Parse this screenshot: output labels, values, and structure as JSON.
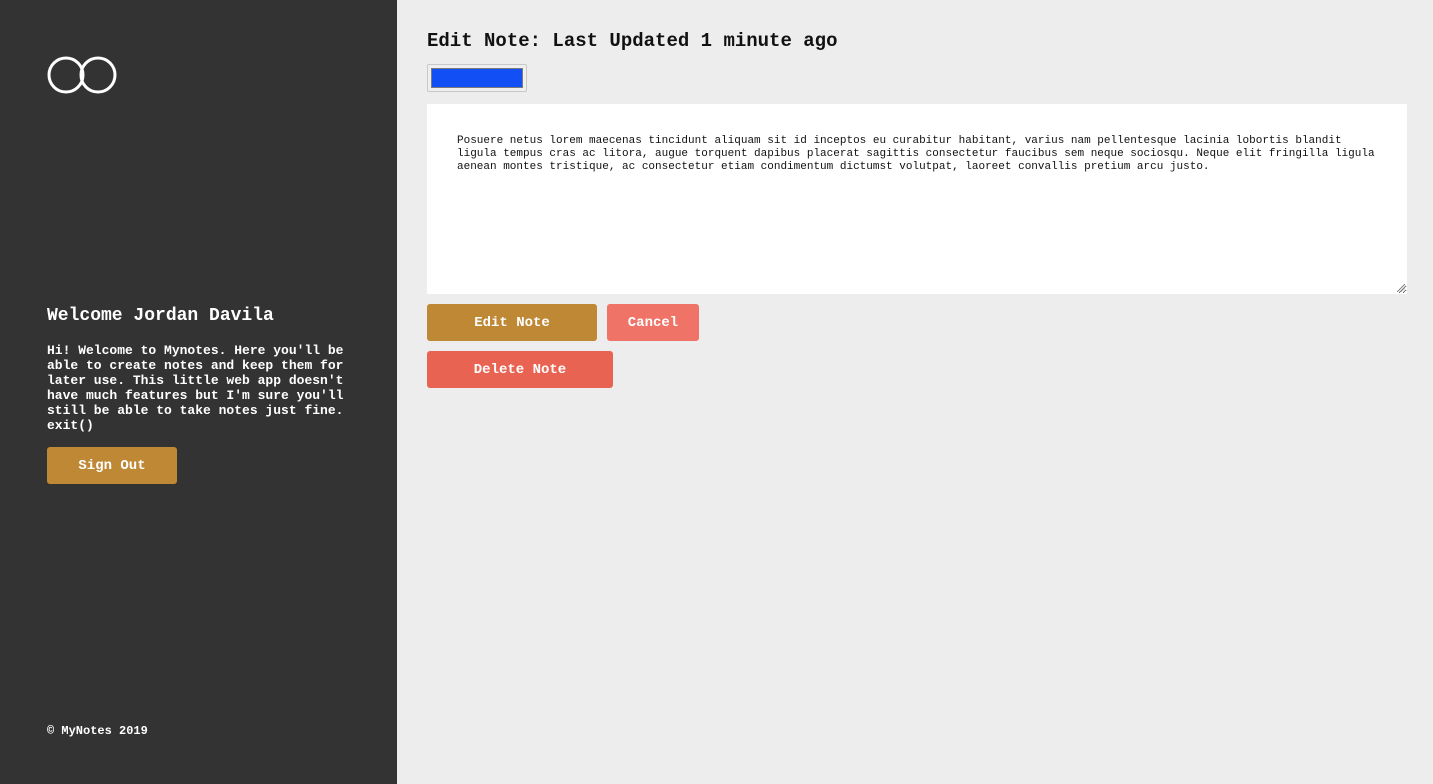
{
  "sidebar": {
    "logo_icon": "infinity-rings-icon",
    "welcome_title": "Welcome Jordan Davila",
    "welcome_lines": [
      "Hi! Welcome to Mynotes. Here you'll be",
      "able to create notes and keep them for",
      "later use. This little web app doesn't",
      "have much features but I'm sure you'll",
      "still be able to take notes just fine.",
      "exit()"
    ],
    "signout_label": "Sign Out",
    "footer": "© MyNotes 2019"
  },
  "main": {
    "title": "Edit Note: Last Updated 1 minute ago",
    "note_color": "#1250f5",
    "note_lines": [
      "Posuere netus lorem maecenas tincidunt aliquam sit id inceptos eu curabitur habitant, varius nam pellentesque lacinia lobortis blandit",
      "ligula tempus cras ac litora, augue torquent dapibus placerat sagittis consectetur faucibus sem neque sociosqu. Neque elit fringilla ligula",
      "aenean montes tristique, ac consectetur etiam condimentum dictumst volutpat, laoreet convallis pretium arcu justo."
    ],
    "edit_label": "Edit Note",
    "cancel_label": "Cancel",
    "delete_label": "Delete Note"
  },
  "colors": {
    "sidebar_bg": "#333333",
    "main_bg": "#ededed",
    "primary_button": "#be8835",
    "cancel_button": "#ef7467",
    "delete_button": "#e96352"
  }
}
